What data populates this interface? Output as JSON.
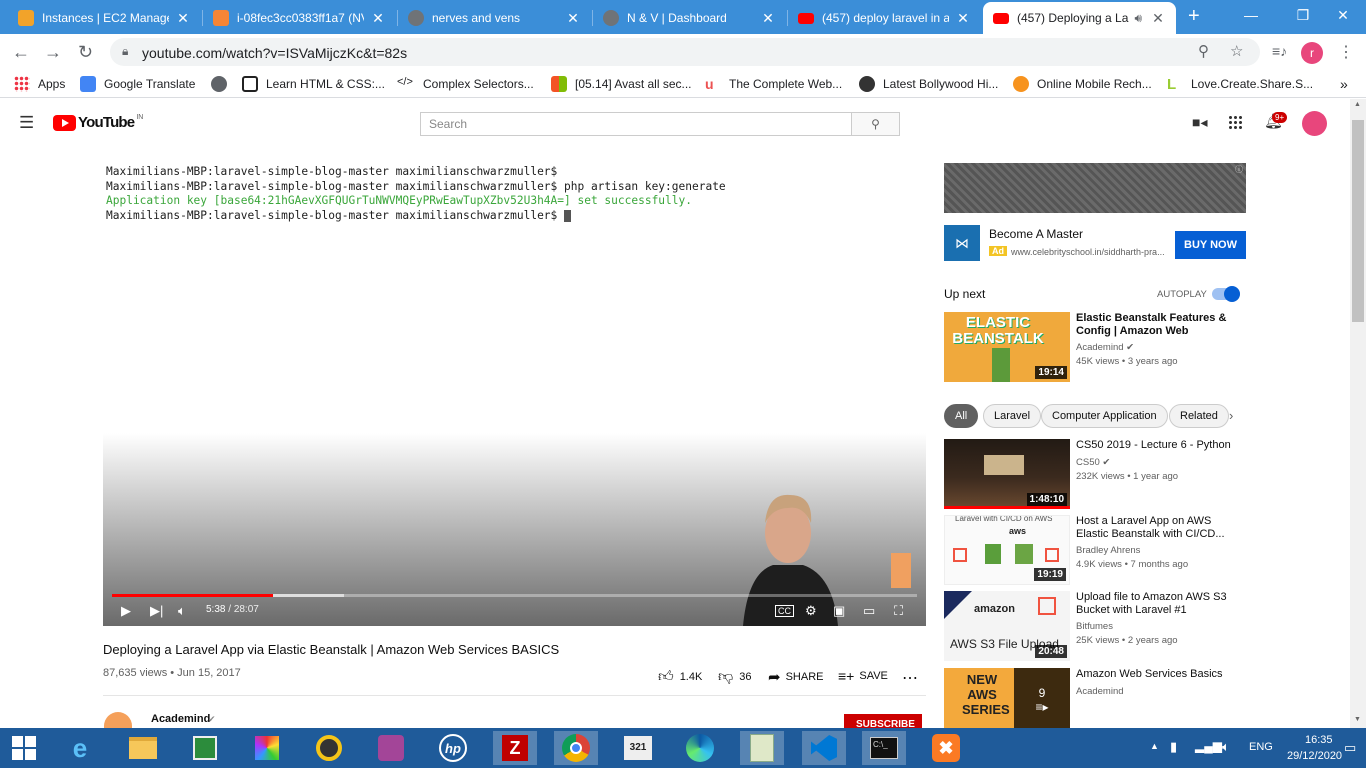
{
  "browser": {
    "tabs": [
      {
        "title": "Instances | EC2 Managem",
        "icon": "aws-icon",
        "color": "#f2a32a"
      },
      {
        "title": "i-08fec3cc0383ff1a7 (NV",
        "icon": "aws-ec2-icon",
        "color": "#f58536"
      },
      {
        "title": "nerves and vens",
        "icon": "globe-icon",
        "color": "#5f6368"
      },
      {
        "title": "N & V | Dashboard",
        "icon": "globe-icon",
        "color": "#5f6368"
      },
      {
        "title": "(457) deploy laravel in a",
        "icon": "youtube-icon",
        "color": "#ff0000"
      },
      {
        "title": "(457) Deploying a La",
        "icon": "youtube-icon",
        "color": "#ff0000"
      }
    ],
    "url": "youtube.com/watch?v=ISVaMijczKc&t=82s",
    "profile_initial": "r",
    "bookmarks": [
      {
        "label": "Apps",
        "icon": "apps-grid-icon"
      },
      {
        "label": "Google Translate",
        "icon": "google-translate-icon"
      },
      {
        "label": "",
        "icon": "globe-icon"
      },
      {
        "label": "Learn HTML & CSS:...",
        "icon": "c-icon"
      },
      {
        "label": "Complex Selectors...",
        "icon": "code-icon"
      },
      {
        "label": "[05.14] Avast all sec...",
        "icon": "windows-icon"
      },
      {
        "label": "The Complete Web...",
        "icon": "udemy-icon"
      },
      {
        "label": "Latest Bollywood Hi...",
        "icon": "avatar-icon"
      },
      {
        "label": "Online Mobile Rech...",
        "icon": "recharge-icon"
      },
      {
        "label": "Love.Create.Share.S...",
        "icon": "l-icon"
      }
    ],
    "more": "»"
  },
  "youtube": {
    "logo": "YouTube",
    "logo_country": "IN",
    "search_placeholder": "Search",
    "notification_badge": "9+",
    "terminal_lines": [
      {
        "text": "Maximilians-MBP:laravel-simple-blog-master maximilianschwarzmuller$",
        "color": "normal"
      },
      {
        "text": "Maximilians-MBP:laravel-simple-blog-master maximilianschwarzmuller$ php artisan key:generate",
        "color": "normal"
      },
      {
        "text": "Application key [base64:21hGAevXGFQUGrTuNWVMQEyPRwEawTupXZbv52U3h4A=] set successfully.",
        "color": "green"
      },
      {
        "text": "Maximilians-MBP:laravel-simple-blog-master maximilianschwarzmuller$ ",
        "color": "normal"
      }
    ],
    "player": {
      "current_time": "5:38",
      "duration": "28:07",
      "progress": 0.2,
      "loaded": 0.288
    },
    "video": {
      "title": "Deploying a Laravel App via Elastic Beanstalk | Amazon Web Services BASICS",
      "meta": "87,635 views • Jun 15, 2017",
      "likes": "1.4K",
      "dislikes": "36",
      "share": "SHARE",
      "save": "SAVE",
      "channel": "Academind",
      "subscribe": "SUBSCRIBE"
    },
    "ad": {
      "title": "Become A Master",
      "badge": "Ad",
      "url": "www.celebrityschool.in/siddharth-pra...",
      "cta": "BUY NOW"
    },
    "up_next_label": "Up next",
    "autoplay_label": "AUTOPLAY",
    "chips": [
      "All",
      "Laravel",
      "Computer Application",
      "Related"
    ],
    "videos": [
      {
        "title": "Elastic Beanstalk Features & Config | Amazon Web Services...",
        "channel": "Academind",
        "views": "45K views • 3 years ago",
        "duration": "19:14",
        "thumb_text": "ELASTIC BEANSTALK"
      },
      {
        "title": "CS50 2019 - Lecture 6 - Python",
        "channel": "CS50",
        "views": "232K views • 1 year ago",
        "duration": "1:48:10",
        "thumb_text": ""
      },
      {
        "title": "Host a Laravel App on AWS Elastic Beanstalk with CI/CD...",
        "channel": "Bradley Ahrens",
        "views": "4.9K views • 7 months ago",
        "duration": "19:19",
        "thumb_text": "Laravel with CI/CD on AWS"
      },
      {
        "title": "Upload file to Amazon AWS S3 Bucket with Laravel #1",
        "channel": "Bitfumes",
        "views": "25K views • 2 years ago",
        "duration": "20:48",
        "thumb_text": "AWS S3 File Upload"
      },
      {
        "title": "Amazon Web Services Basics",
        "channel": "Academind",
        "views": "",
        "duration": "9",
        "thumb_text": "NEW AWS SERIES"
      }
    ]
  },
  "taskbar": {
    "apps": [
      "windows-start-icon",
      "internet-explorer-icon",
      "file-explorer-icon",
      "store-icon",
      "paint-icon",
      "media-player-icon",
      "presentation-icon",
      "hp-icon",
      "filezilla-icon",
      "chrome-icon",
      "media-player-classic-icon",
      "edge-icon",
      "notepad-plus-icon",
      "vscode-icon",
      "cmd-icon",
      "xampp-icon"
    ],
    "lang": "ENG",
    "time": "16:35",
    "date": "29/12/2020"
  }
}
